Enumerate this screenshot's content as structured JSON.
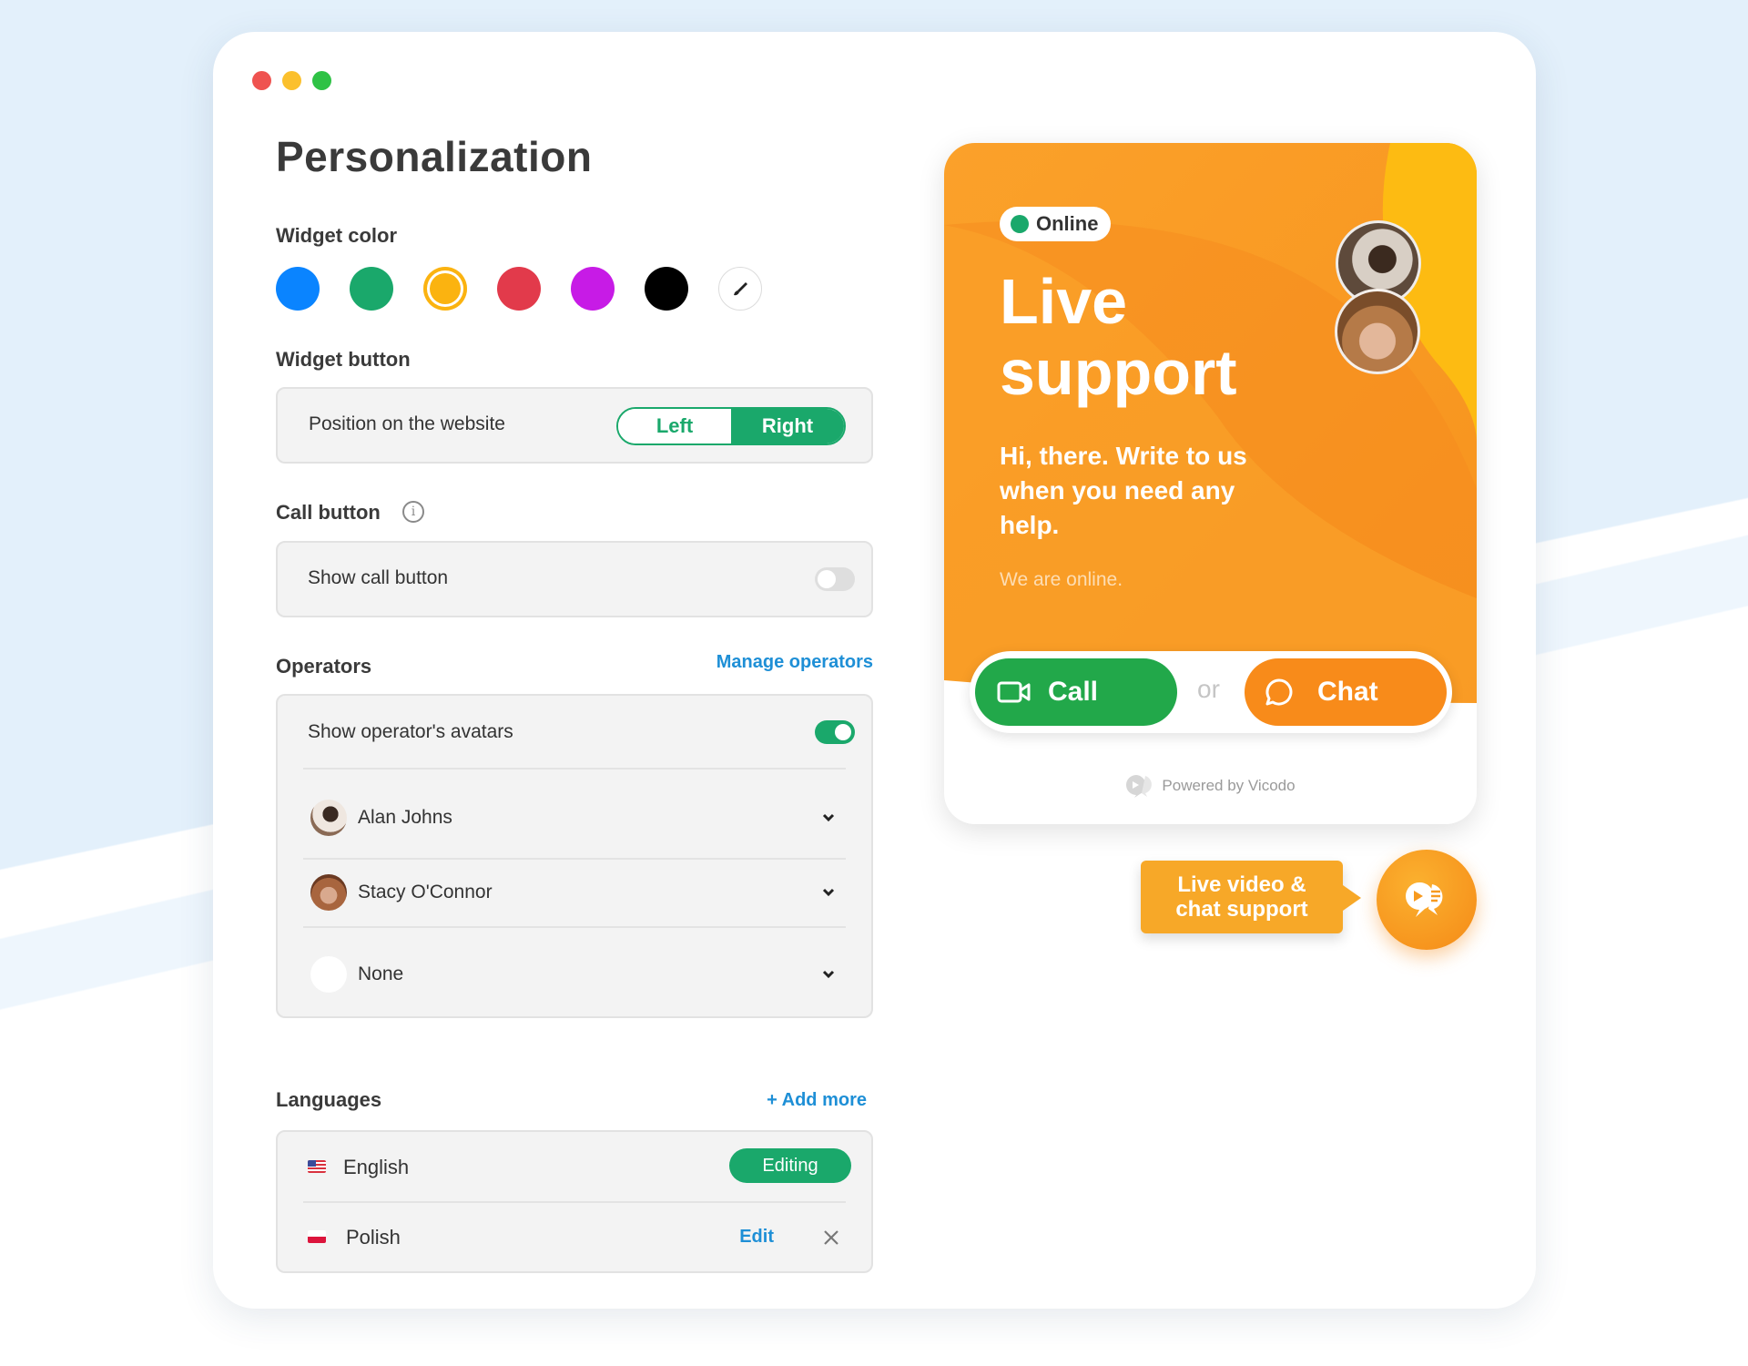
{
  "colors": {
    "green": "#1aa86b",
    "orange": "#f88b1a",
    "link": "#1e8fd6"
  },
  "page": {
    "title": "Personalization"
  },
  "widget_color": {
    "label": "Widget color",
    "swatches": [
      "#0a84ff",
      "#1aa86b",
      "#fbb310",
      "#e23a4b",
      "#c71be6",
      "#000000"
    ],
    "selected": "#fbb310",
    "picker_icon": "brush-icon"
  },
  "widget_button": {
    "label": "Widget button",
    "position_label": "Position on the website",
    "options": [
      "Left",
      "Right"
    ],
    "selected": "Right"
  },
  "call_button": {
    "label": "Call button",
    "show_label": "Show call button",
    "enabled": false
  },
  "operators": {
    "label": "Operators",
    "manage_link": "Manage operators",
    "show_avatars_label": "Show operator's avatars",
    "show_avatars": true,
    "list": [
      {
        "name": "Alan Johns"
      },
      {
        "name": "Stacy O'Connor"
      },
      {
        "name": "None"
      }
    ]
  },
  "languages": {
    "label": "Languages",
    "add_link": "+ Add more",
    "items": [
      {
        "name": "English",
        "action": "Editing"
      },
      {
        "name": "Polish",
        "action": "Edit"
      }
    ]
  },
  "preview": {
    "status": "Online",
    "title": "Live support",
    "subtitle": "Hi, there. Write to us when you need any help.",
    "status_text": "We are online.",
    "call_label": "Call",
    "or_label": "or",
    "chat_label": "Chat",
    "powered_by": "Powered by Vicodo"
  },
  "launcher": {
    "bubble_text": "Live video & chat support"
  }
}
